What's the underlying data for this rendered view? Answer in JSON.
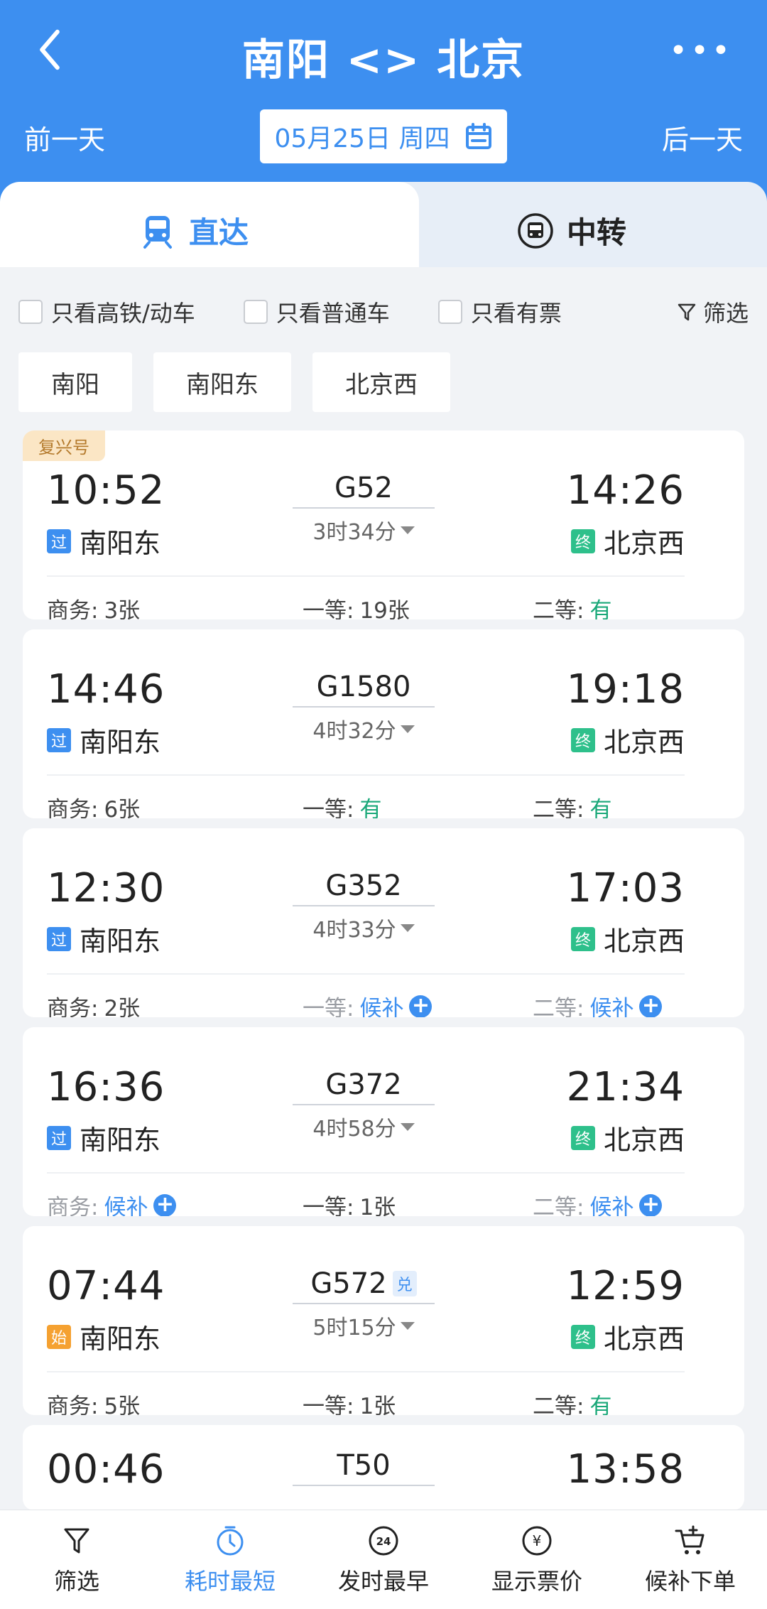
{
  "header": {
    "title": "南阳 <> 北京",
    "prev_day": "前一天",
    "next_day": "后一天",
    "date": "05月25日 周四",
    "more": "•••"
  },
  "tabs": {
    "direct": "直达",
    "transfer": "中转"
  },
  "filters": {
    "high_speed": "只看高铁/动车",
    "normal": "只看普通车",
    "available": "只看有票",
    "filter": "筛选"
  },
  "stations": [
    "南阳",
    "南阳东",
    "北京西"
  ],
  "trains": [
    {
      "badge": "复兴号",
      "dep_time": "10:52",
      "dep_tag": "过",
      "dep_station": "南阳东",
      "train_no": "G52",
      "duration": "3时34分",
      "arr_time": "14:26",
      "arr_tag": "终",
      "arr_station": "北京西",
      "seats": [
        {
          "label": "商务:",
          "value": "3张",
          "style": ""
        },
        {
          "label": "一等:",
          "value": "19张",
          "style": ""
        },
        {
          "label": "二等:",
          "value": "有",
          "style": "green"
        }
      ]
    },
    {
      "dep_time": "14:46",
      "dep_tag": "过",
      "dep_station": "南阳东",
      "train_no": "G1580",
      "duration": "4时32分",
      "arr_time": "19:18",
      "arr_tag": "终",
      "arr_station": "北京西",
      "seats": [
        {
          "label": "商务:",
          "value": "6张",
          "style": ""
        },
        {
          "label": "一等:",
          "value": "有",
          "style": "green"
        },
        {
          "label": "二等:",
          "value": "有",
          "style": "green"
        }
      ]
    },
    {
      "dep_time": "12:30",
      "dep_tag": "过",
      "dep_station": "南阳东",
      "train_no": "G352",
      "duration": "4时33分",
      "arr_time": "17:03",
      "arr_tag": "终",
      "arr_station": "北京西",
      "seats": [
        {
          "label": "商务:",
          "value": "2张",
          "style": ""
        },
        {
          "label": "一等:",
          "value": "候补",
          "style": "blue"
        },
        {
          "label": "二等:",
          "value": "候补",
          "style": "blue"
        }
      ]
    },
    {
      "dep_time": "16:36",
      "dep_tag": "过",
      "dep_station": "南阳东",
      "train_no": "G372",
      "duration": "4时58分",
      "arr_time": "21:34",
      "arr_tag": "终",
      "arr_station": "北京西",
      "seats": [
        {
          "label": "商务:",
          "value": "候补",
          "style": "blue"
        },
        {
          "label": "一等:",
          "value": "1张",
          "style": ""
        },
        {
          "label": "二等:",
          "value": "候补",
          "style": "blue"
        }
      ]
    },
    {
      "dep_time": "07:44",
      "dep_tag": "始",
      "dep_station": "南阳东",
      "train_no": "G572",
      "train_badge": "兑",
      "duration": "5时15分",
      "arr_time": "12:59",
      "arr_tag": "终",
      "arr_station": "北京西",
      "seats": [
        {
          "label": "商务:",
          "value": "5张",
          "style": ""
        },
        {
          "label": "一等:",
          "value": "1张",
          "style": ""
        },
        {
          "label": "二等:",
          "value": "有",
          "style": "green"
        }
      ]
    }
  ],
  "partial_train": {
    "dep_time": "00:46",
    "train_no": "T50",
    "arr_time": "13:58"
  },
  "bottom_nav": [
    {
      "label": "筛选",
      "icon": "filter-icon"
    },
    {
      "label": "耗时最短",
      "icon": "timer-icon",
      "active": true
    },
    {
      "label": "发时最早",
      "icon": "clock-24-icon"
    },
    {
      "label": "显示票价",
      "icon": "yuan-icon"
    },
    {
      "label": "候补下单",
      "icon": "cart-plus-icon"
    }
  ]
}
